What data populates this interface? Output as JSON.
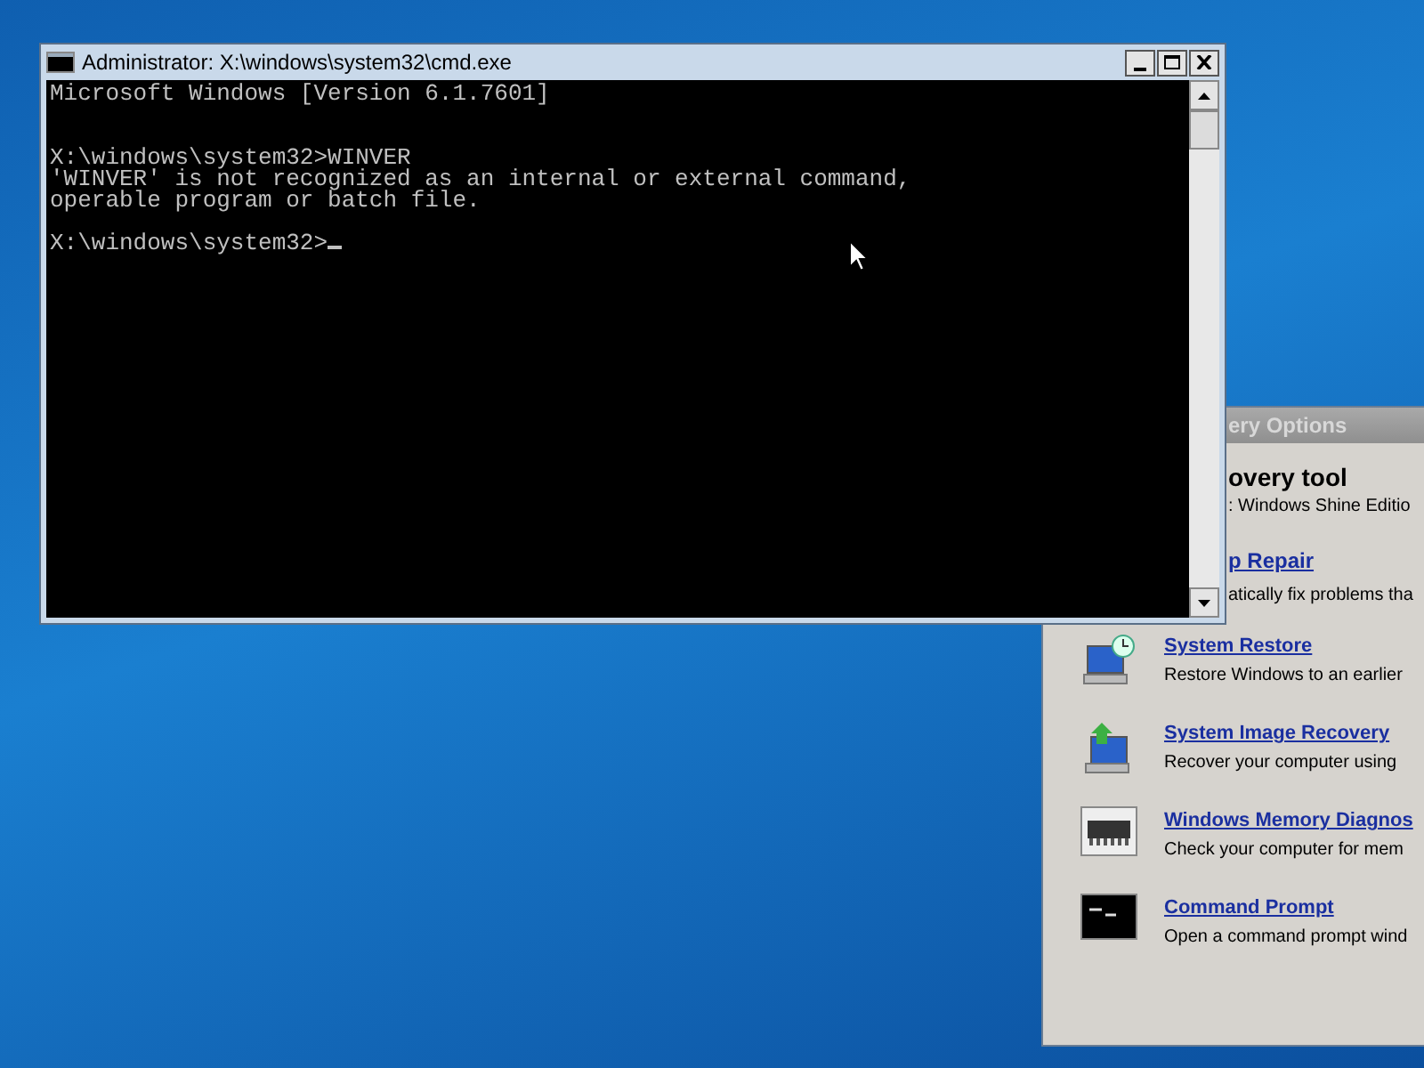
{
  "console_window": {
    "title": "Administrator: X:\\windows\\system32\\cmd.exe",
    "blocks": [
      [
        "Microsoft Windows [Version 6.1.7601]"
      ],
      [
        "X:\\windows\\system32>WINVER",
        "'WINVER' is not recognized as an internal or external command,",
        "operable program or batch file."
      ],
      [
        "X:\\windows\\system32>"
      ]
    ]
  },
  "recovery_window": {
    "title": "ery Options",
    "heading": "overy tool",
    "os_line": ": Windows Shine Editio",
    "partial_tool": {
      "name": "p Repair",
      "description": "atically fix problems tha"
    },
    "tools": [
      {
        "kind": "restore",
        "name": "System Restore",
        "description": "Restore Windows to an earlier"
      },
      {
        "kind": "image",
        "name": "System Image Recovery",
        "description": "Recover your computer using"
      },
      {
        "kind": "memory",
        "name": "Windows Memory Diagnos",
        "description": "Check your computer for mem"
      },
      {
        "kind": "prompt",
        "name": "Command Prompt",
        "description": "Open a command prompt wind"
      }
    ]
  }
}
